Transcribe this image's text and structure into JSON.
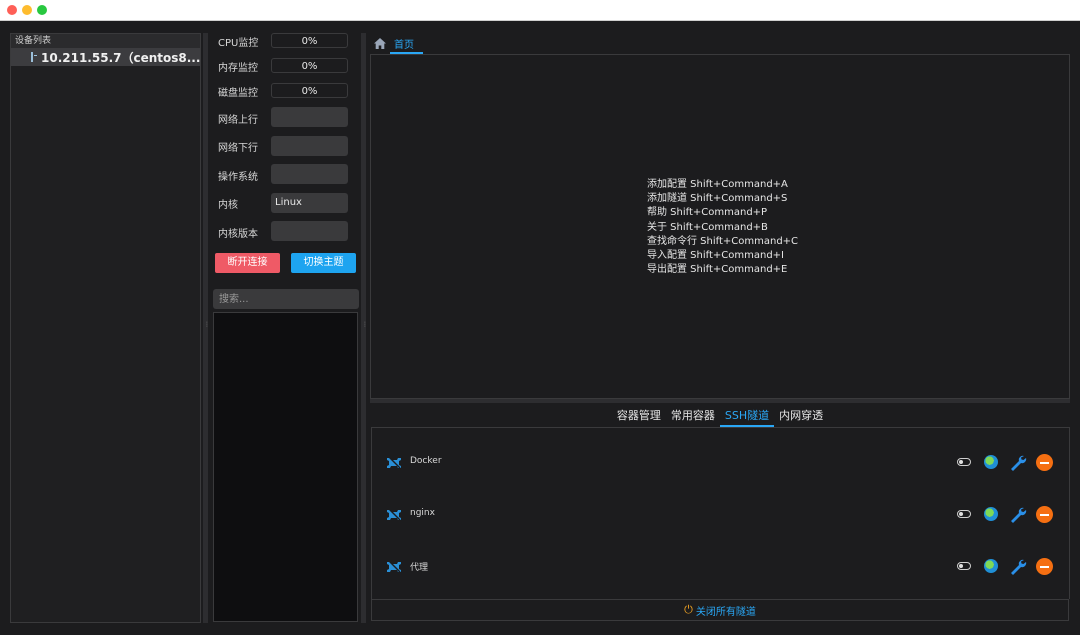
{
  "device_list": {
    "header": "设备列表",
    "items": [
      {
        "label": "10.211.55.7（centos8...."
      }
    ]
  },
  "monitor": {
    "cpu_label": "CPU监控",
    "cpu_value": "0%",
    "mem_label": "内存监控",
    "mem_value": "0%",
    "disk_label": "磁盘监控",
    "disk_value": "0%",
    "net_up_label": "网络上行",
    "net_up_value": "",
    "net_down_label": "网络下行",
    "net_down_value": "",
    "os_label": "操作系统",
    "os_value": "",
    "kernel_label": "内核",
    "kernel_value": "Linux",
    "kernel_version_label": "内核版本",
    "kernel_version_value": "",
    "disconnect_button": "断开连接",
    "theme_button": "切换主题",
    "search_placeholder": "搜索..."
  },
  "main": {
    "home_tab": "首页",
    "shortcuts": [
      "添加配置 Shift+Command+A",
      "添加隧道 Shift+Command+S",
      "帮助 Shift+Command+P",
      "关于 Shift+Command+B",
      "查找命令行 Shift+Command+C",
      "导入配置 Shift+Command+I",
      "导出配置 Shift+Command+E"
    ]
  },
  "bottom_tabs": [
    {
      "label": "容器管理",
      "active": false
    },
    {
      "label": "常用容器",
      "active": false
    },
    {
      "label": "SSH隧道",
      "active": true
    },
    {
      "label": "内网穿透",
      "active": false
    }
  ],
  "tunnels": [
    {
      "name": "Docker",
      "enabled": false
    },
    {
      "name": "nginx",
      "enabled": false
    },
    {
      "name": "代理",
      "enabled": false
    }
  ],
  "close_all_button": "关闭所有隧道",
  "colors": {
    "accent": "#2aa7f5",
    "danger": "#ef5a66",
    "remove": "#f56f12",
    "power": "#f5a623"
  }
}
